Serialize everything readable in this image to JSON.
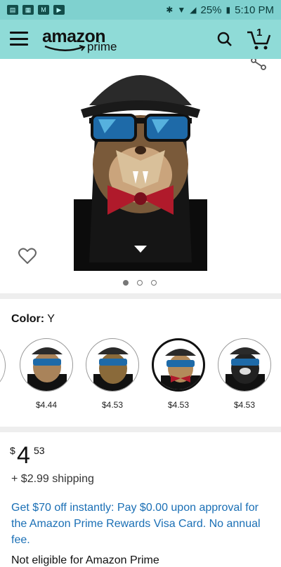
{
  "status_bar": {
    "battery": "25%",
    "time": "5:10 PM"
  },
  "app_bar": {
    "logo_text": "amazon",
    "logo_sub": "prime",
    "cart_count": "1"
  },
  "gallery": {
    "pages": 3,
    "active_page": 1
  },
  "color": {
    "label": "Color:",
    "value": "Y",
    "options": [
      {
        "price": "$4.44"
      },
      {
        "price": "$4.53"
      },
      {
        "price": "$4.53"
      },
      {
        "price": "$4.53"
      }
    ]
  },
  "price": {
    "currency": "$",
    "whole": "4",
    "fraction": "53",
    "shipping": "+ $2.99 shipping",
    "promo": "Get $70 off instantly: Pay $0.00 upon approval for the Amazon Prime Rewards Visa Card. No annual fee.",
    "eligibility": "Not eligible for Amazon Prime"
  }
}
